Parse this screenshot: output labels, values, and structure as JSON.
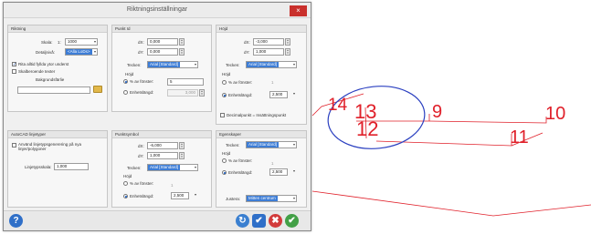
{
  "dialog": {
    "title": "Riktningsinställningar",
    "close_glyph": "×"
  },
  "riktning": {
    "header": "Riktning",
    "skala_label": "Skala:",
    "skala_prefix": "1:",
    "skala_value": "1000",
    "detalj_label": "Detaljnivå:",
    "detalj_value": "<Alla LoDs>",
    "check_fill_label": "Rita alltid fyllda ytor underst",
    "check_fill_checked": true,
    "check_text_label": "Skalberoende texter",
    "check_text_checked": false,
    "bg_label": "Bakgrundsfärlie",
    "bg_value": ""
  },
  "punkt_id": {
    "header": "Punkt Id",
    "dx_label": "dX:",
    "dx_value": "0,000",
    "dy_label": "dY:",
    "dy_value": "0,000",
    "tecken_label": "Tecken:",
    "tecken_value": "Arial [Standard]",
    "hojd_label": "Höjd",
    "pct_label": "% av fönster:",
    "pct_value": "5",
    "enhet_label": "Enhetslängd:",
    "enhet_value": "3,000"
  },
  "hojd": {
    "header": "Höjd",
    "dx_label": "dX:",
    "dx_value": "-3,000",
    "dy_label": "dY:",
    "dy_value": "1,000",
    "tecken_label": "Tecken:",
    "tecken_value": "Arial [Standard]",
    "hojd_label": "Höjd",
    "pct_label": "% av fönster:",
    "pct_value": "1",
    "enhet_label": "Enhetslängd:",
    "enhet_value": "2,500",
    "decimal_label": "Decimalpunkt = Insättningspunkt"
  },
  "autocad": {
    "header": "AutoCAD linjetyper",
    "check_label": "Använd linjetypsgenerering på nya linjer/polygoner",
    "skala_label": "Linjetypsskala:",
    "skala_value": "1,000"
  },
  "punktsymbol": {
    "header": "Punktsymbol",
    "dx_label": "dX:",
    "dx_value": "-6,000",
    "dy_label": "dY:",
    "dy_value": "1,000",
    "tecken_label": "Tecken:",
    "tecken_value": "Arial [Standard]",
    "hojd_label": "Höjd",
    "pct_label": "% av fönster:",
    "pct_value": "1",
    "enhet_label": "Enhetslängd:",
    "enhet_value": "2,500"
  },
  "egenskaper": {
    "header": "Egenskaper",
    "tecken_label": "Tecken:",
    "tecken_value": "Arial [Standard]",
    "hojd_label": "Höjd",
    "pct_label": "% av fönster:",
    "pct_value": "1",
    "enhet_label": "Enhetslängd:",
    "enhet_value": "2,500",
    "justera_label": "Justera:",
    "justera_value": "Mitten centrum"
  },
  "buttons": {
    "help_glyph": "?",
    "refresh_glyph": "↻",
    "ok_glyph": "✔",
    "cancel_glyph": "✖",
    "apply_glyph": "✔"
  },
  "drawing": {
    "labels": [
      "14",
      "13",
      "12",
      "9",
      "10",
      "11"
    ],
    "line_color": "#e0202a",
    "highlight_color": "#2a3fc0"
  }
}
